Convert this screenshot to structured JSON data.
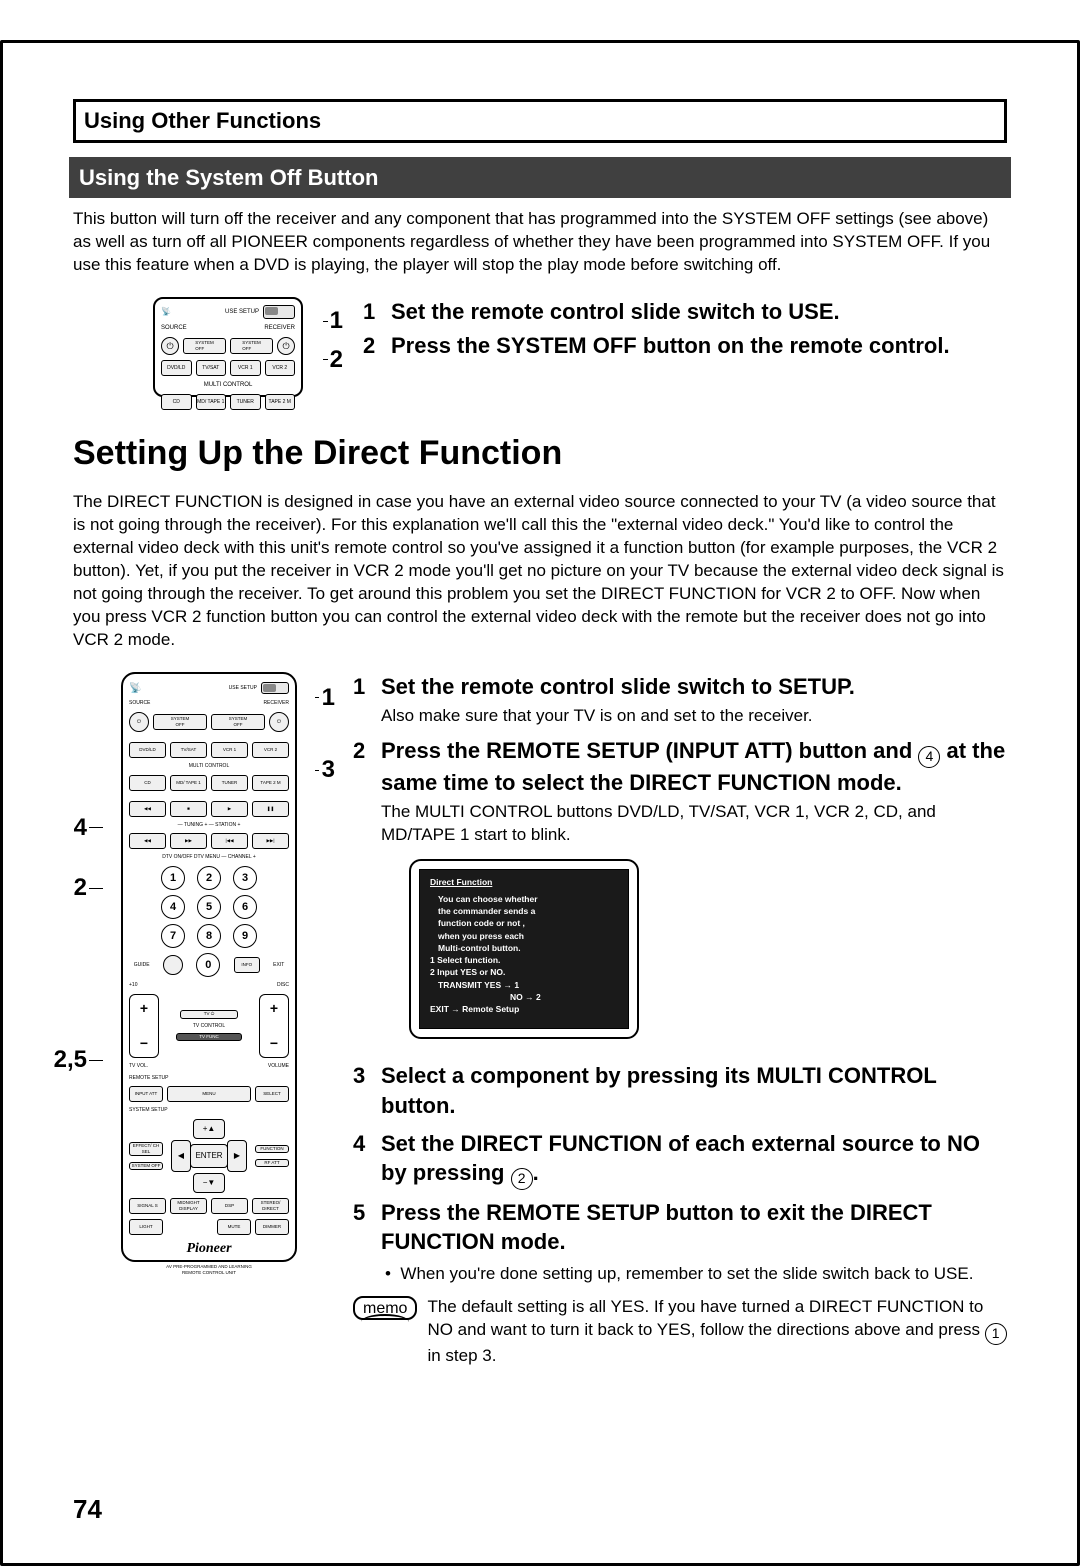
{
  "section_header": "Using Other Functions",
  "subheading": "Using the System Off Button",
  "intro_paragraph": "This button will turn off the receiver and any component that has programmed into the SYSTEM OFF settings (see above) as well as turn off all PIONEER components regardless of whether they have been programmed into SYSTEM OFF. If you use this feature when a DVD is playing, the player will stop the play mode before switching off.",
  "top_steps": {
    "s1_num": "1",
    "s1_text": "Set the remote control slide switch to USE.",
    "s2_num": "2",
    "s2_text": "Press the SYSTEM OFF button on the remote control."
  },
  "page_title": "Setting Up the Direct Function",
  "direct_paragraph": "The DIRECT FUNCTION is designed in case you have an external video source connected to your TV (a video source that is not going through the receiver). For this explanation we'll call this the  \"external video deck.\" You'd like to control the external video deck with this unit's remote control so you've assigned it a function button (for example purposes, the VCR 2 button). Yet, if you put the receiver in VCR 2 mode you'll get no picture on your TV because the external video deck signal is not going through the receiver. To get around this problem you set the DIRECT FUNCTION for VCR 2 to OFF. Now when you press VCR 2  function button you can control the external video deck with the remote but the receiver does not go into VCR 2 mode.",
  "main_steps": {
    "s1_num": "1",
    "s1_text": "Set the remote control slide switch to SETUP.",
    "s1_sub": "Also make sure that your TV is on and set to the receiver.",
    "s2_num": "2",
    "s2_text_a": "Press the REMOTE SETUP (INPUT ATT) button and ",
    "s2_text_b": " at the same time to select the DIRECT FUNCTION mode.",
    "s2_sub": "The MULTI CONTROL buttons DVD/LD, TV/SAT, VCR 1, VCR 2, CD, and MD/TAPE 1 start to blink.",
    "s3_num": "3",
    "s3_text": "Select a component by pressing its MULTI CONTROL button.",
    "s4_num": "4",
    "s4_text_a": "Set the DIRECT FUNCTION of each external source to NO by pressing ",
    "s4_text_b": ".",
    "s5_num": "5",
    "s5_text": "Press the REMOTE SETUP button to exit the DIRECT FUNCTION  mode.",
    "s5_bullet": "When you're done setting up, remember to set the slide switch back to USE."
  },
  "memo_label": "memo",
  "memo_text_a": "The default setting is all YES. If you have turned a DIRECT FUNCTION to NO and want to turn it back to YES, follow the directions above and press ",
  "memo_text_b": "  in step 3.",
  "circled_4": "4",
  "circled_2": "2",
  "circled_1": "1",
  "callouts_top": {
    "a": "1",
    "b": "2"
  },
  "callouts_left": {
    "a": "4",
    "b": "2",
    "c": "2,5"
  },
  "callouts_right": {
    "a": "1",
    "b": "3"
  },
  "remote_small": {
    "source_label": "SOURCE",
    "receiver_label": "RECEIVER",
    "use_setup": "USE    SETUP",
    "row2": [
      "DVD/LD",
      "TV/SAT",
      "VCR 1",
      "VCR 2"
    ],
    "multi_label": "MULTI CONTROL",
    "row3": [
      "CD",
      "MD/\nTAPE 1",
      "TUNER",
      "TAPE 2 M"
    ]
  },
  "remote_large": {
    "top_row": {
      "source": "SOURCE",
      "use_setup": "USE    SETUP",
      "receiver": "RECEIVER"
    },
    "multi_row": [
      "DVD/LD",
      "TV/SAT",
      "VCR 1",
      "VCR 2"
    ],
    "multi_label": "MULTI CONTROL",
    "multi_row2": [
      "CD",
      "MD/\nTAPE 1",
      "TUNER",
      "TAPE 2 M"
    ],
    "transport": [
      "◀◀",
      "■",
      "▶",
      "❚❚"
    ],
    "tuning_label": "—   TUNING   +              —   STATION   +",
    "seek": [
      "◀◀",
      "▶▶",
      "|◀◀",
      "▶▶|"
    ],
    "dtv_label": "DTV ON/OFF    DTV MENU             —  CHANNEL  +",
    "numbers": [
      "1",
      "2",
      "3",
      "4",
      "5",
      "6",
      "7",
      "8",
      "9",
      "0"
    ],
    "guide": "GUIDE",
    "info": "INFO",
    "exit": "EXIT",
    "disc": "DISC",
    "plus10": "+10",
    "tv_vol": "TV VOL.",
    "tv_ctrl": "TV CONTROL",
    "volume": "VOLUME",
    "tv_power": "TV ⏻",
    "tv_func": "TV FUNC",
    "remote_setup": "REMOTE SETUP",
    "input_att": "INPUT\nATT",
    "menu": "MENU",
    "select": "SELECT",
    "system_setup": "SYSTEM SETUP",
    "effect": "EFFECT/\nCH SEL",
    "function": "FUNCTION",
    "sys_off": "SYSTEM\nOFF",
    "enter": "ENTER",
    "rf_att": "RF\nATT",
    "bottom_row1": [
      "SIGNAL S",
      "MIDNIGHT\nDISPLAY",
      "DSP",
      "STEREO/\nDIRECT"
    ],
    "bottom_row2": [
      "LIGHT",
      "MUTE",
      "DIMMER"
    ],
    "brand": "Pioneer",
    "brand_sub": "AV PRE-PROGRAMMED AND LEARNING\nREMOTE CONTROL UNIT"
  },
  "tv_screen": {
    "title": "Direct Function",
    "l1": "You can choose whether",
    "l2": "the commander sends a",
    "l3": "function code or not ,",
    "l4": "when you press each",
    "l5": "Multi-control button.",
    "l6": "1 Select function.",
    "l7": "2 Input  YES or NO.",
    "l8": "TRANSMIT    YES → 1",
    "l9": "NO  → 2",
    "l10": "EXIT → Remote Setup"
  },
  "page_number": "74"
}
